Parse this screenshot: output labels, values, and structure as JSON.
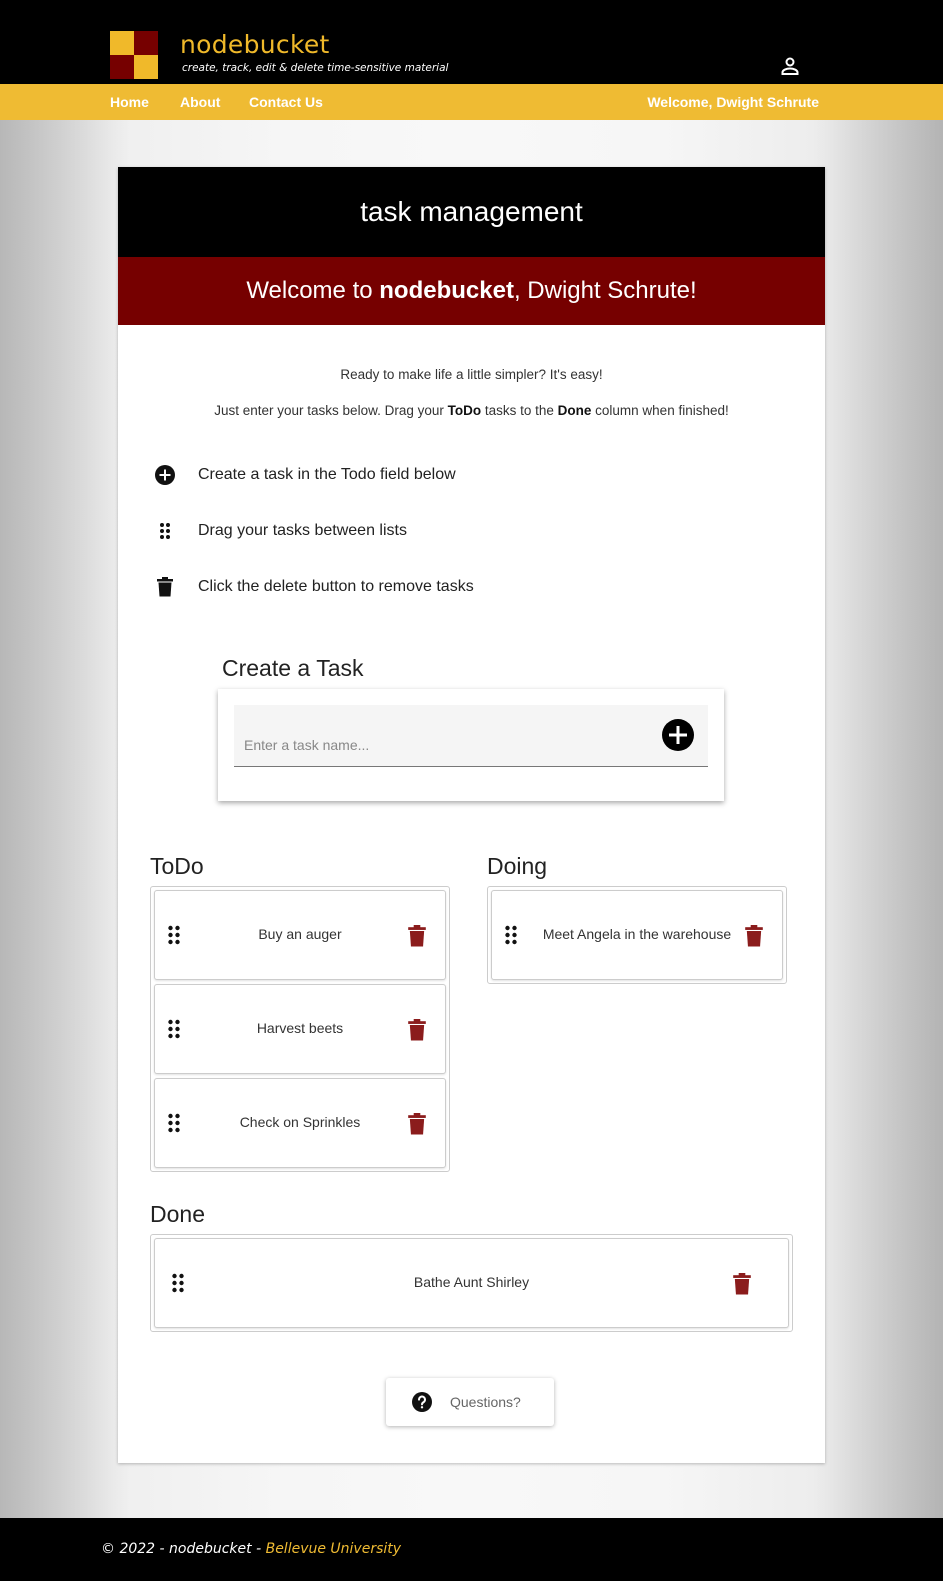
{
  "header": {
    "brand_name": "nodebucket",
    "tagline": "create, track, edit & delete time-sensitive material",
    "logo_colors": [
      "#f0b92a",
      "#760000",
      "#760000",
      "#f0b92a"
    ]
  },
  "nav": {
    "items": [
      "Home",
      "About",
      "Contact Us"
    ],
    "welcome": "Welcome, Dwight Schrute"
  },
  "card": {
    "title": "task management",
    "welcome_prefix": "Welcome to ",
    "welcome_brand": "nodebucket",
    "welcome_suffix": ", Dwight Schrute!",
    "intro_line1": "Ready to make life a little simpler? It's easy!",
    "intro_line2_part1": "Just enter your tasks below. Drag your ",
    "intro_line2_todo": "ToDo",
    "intro_line2_part2": " tasks to the ",
    "intro_line2_done": "Done",
    "intro_line2_part3": " column when finished!",
    "steps": [
      {
        "icon": "add-circle-icon",
        "text": "Create a task in the Todo field below"
      },
      {
        "icon": "drag-handle-icon",
        "text": "Drag your tasks between lists"
      },
      {
        "icon": "trash-icon",
        "text": "Click the delete button to remove tasks"
      }
    ]
  },
  "create_task": {
    "title": "Create a Task",
    "placeholder": "Enter a task name...",
    "value": ""
  },
  "lists": {
    "todo": {
      "title": "ToDo",
      "tasks": [
        "Buy an auger",
        "Harvest beets",
        "Check on Sprinkles"
      ]
    },
    "doing": {
      "title": "Doing",
      "tasks": [
        "Meet Angela in the warehouse"
      ]
    },
    "done": {
      "title": "Done",
      "tasks": [
        "Bathe Aunt Shirley"
      ]
    }
  },
  "questions_button": {
    "label": "Questions?",
    "icon": "help-circle-icon"
  },
  "footer": {
    "copyright": "© 2022 - nodebucket - ",
    "link": "Bellevue University"
  },
  "colors": {
    "black": "#000000",
    "gold": "#efbb33",
    "maroon": "#760000",
    "delete_icon": "#8b1c1c"
  }
}
